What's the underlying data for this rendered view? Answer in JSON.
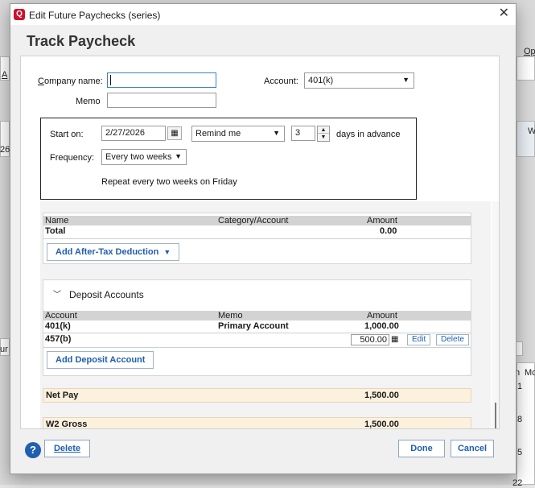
{
  "window": {
    "title": "Edit Future Paychecks (series)",
    "logo_letter": "Q",
    "close_glyph": "✕"
  },
  "heading": "Track Paycheck",
  "form": {
    "company_label": "Company name:",
    "company_value": "",
    "memo_label": "Memo",
    "memo_value": "",
    "account_label": "Account:",
    "account_value": "401(k)"
  },
  "schedule": {
    "start_label": "Start on:",
    "start_value": "2/27/2026",
    "remind_value": "Remind me",
    "days_value": "3",
    "days_suffix": "days in advance",
    "frequency_label": "Frequency:",
    "frequency_value": "Every two weeks",
    "repeat_text": "Repeat every two weeks on Friday"
  },
  "after_tax": {
    "columns": [
      "Name",
      "Category/Account",
      "Amount"
    ],
    "total_label": "Total",
    "total_amount": "0.00",
    "add_button": "Add After-Tax Deduction"
  },
  "deposit": {
    "section_title": "Deposit Accounts",
    "columns": [
      "Account",
      "Memo",
      "Amount"
    ],
    "rows": [
      {
        "account": "401(k)",
        "memo": "Primary Account",
        "amount": "1,000.00"
      },
      {
        "account": "457(b)",
        "memo": "",
        "amount": "500.00"
      }
    ],
    "edit_label": "Edit",
    "delete_label": "Delete",
    "add_button": "Add Deposit Account"
  },
  "summary": {
    "net_pay_label": "Net Pay",
    "net_pay_amount": "1,500.00",
    "w2_label": "W2 Gross",
    "w2_amount": "1,500.00"
  },
  "footer": {
    "help_glyph": "?",
    "delete_label": "Delete",
    "done_label": "Done",
    "cancel_label": "Cancel"
  },
  "background": {
    "top_right_text": "Op",
    "left_a": "A",
    "left_26": "26",
    "left_ur": "ur",
    "right_w": "W",
    "right_n": "n",
    "right_mo": "Mo",
    "right_1": "1",
    "right_8": "8",
    "right_5": "5",
    "right_22": "22"
  },
  "colors": {
    "accent_blue": "#1f5fb0",
    "brand_red": "#d0112b",
    "summary_row": "#fbf1dc"
  }
}
